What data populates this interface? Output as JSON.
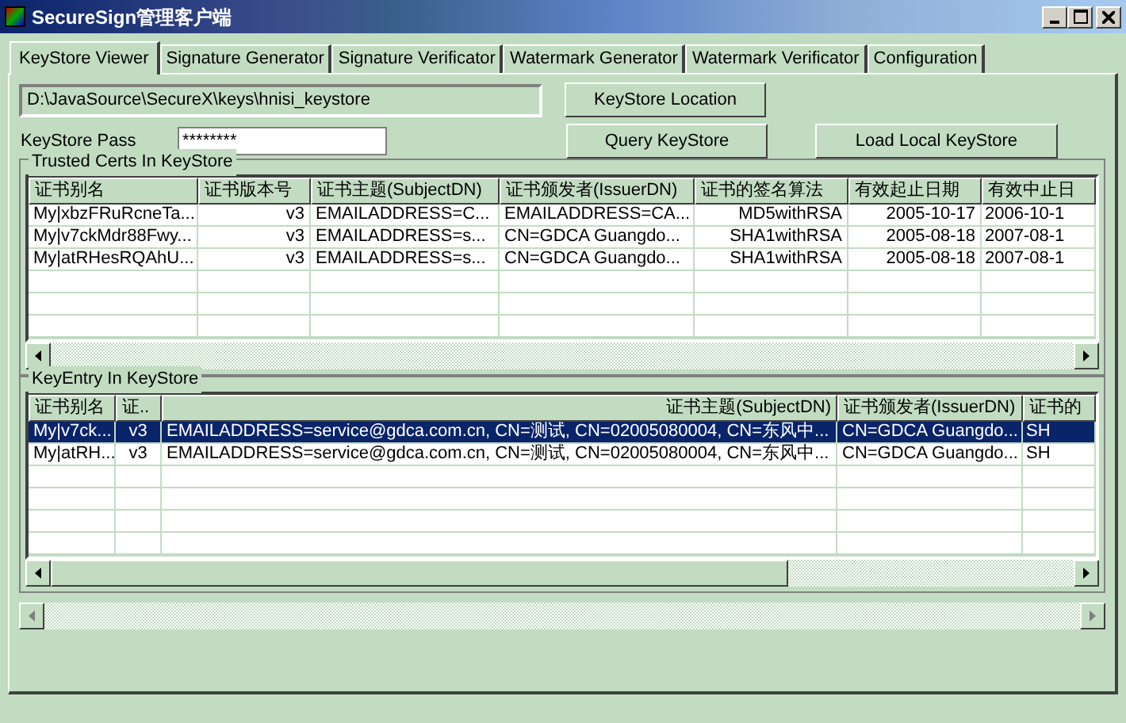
{
  "window": {
    "title": "SecureSign管理客户端"
  },
  "tabs": [
    {
      "label": "KeyStore Viewer",
      "selected": true
    },
    {
      "label": "Signature Generator",
      "selected": false
    },
    {
      "label": "Signature Verificator",
      "selected": false
    },
    {
      "label": "Watermark Generator",
      "selected": false
    },
    {
      "label": "Watermark Verificator",
      "selected": false
    },
    {
      "label": "Configuration",
      "selected": false
    }
  ],
  "keystore_path": {
    "value": "D:\\JavaSource\\SecureX\\keys\\hnisi_keystore"
  },
  "keystore_location_button": "KeyStore Location",
  "keystore_pass": {
    "label": "KeyStore Pass",
    "value": "********"
  },
  "query_button": "Query KeyStore",
  "load_local_button": "Load Local KeyStore",
  "trusted_certs": {
    "title": "Trusted Certs In KeyStore",
    "columns": [
      "证书别名",
      "证书版本号",
      "证书主题(SubjectDN)",
      "证书颁发者(IssuerDN)",
      "证书的签名算法",
      "有效起止日期",
      "有效中止日"
    ],
    "rows": [
      {
        "selected": false,
        "cells": [
          "My|xbzFRuRcneTa...",
          "v3",
          "EMAILADDRESS=C...",
          "EMAILADDRESS=CA...",
          "MD5withRSA",
          "2005-10-17",
          "2006-10-1"
        ]
      },
      {
        "selected": false,
        "cells": [
          "My|v7ckMdr88Fwy...",
          "v3",
          "EMAILADDRESS=s...",
          "CN=GDCA Guangdo...",
          "SHA1withRSA",
          "2005-08-18",
          "2007-08-1"
        ]
      },
      {
        "selected": false,
        "cells": [
          "My|atRHesRQAhU...",
          "v3",
          "EMAILADDRESS=s...",
          "CN=GDCA Guangdo...",
          "SHA1withRSA",
          "2005-08-18",
          "2007-08-1"
        ]
      }
    ]
  },
  "key_entries": {
    "title": "KeyEntry In KeyStore",
    "columns": [
      "证书别名",
      "证..",
      "证书主题(SubjectDN)",
      "证书颁发者(IssuerDN)",
      "证书的"
    ],
    "rows": [
      {
        "selected": true,
        "cells": [
          "My|v7ck...",
          "v3",
          "EMAILADDRESS=service@gdca.com.cn, CN=测试, CN=02005080004, CN=东风中...",
          "CN=GDCA Guangdo...",
          "SH"
        ]
      },
      {
        "selected": false,
        "cells": [
          "My|atRH...",
          "v3",
          "EMAILADDRESS=service@gdca.com.cn, CN=测试, CN=02005080004, CN=东风中...",
          "CN=GDCA Guangdo...",
          "SH"
        ]
      }
    ]
  }
}
